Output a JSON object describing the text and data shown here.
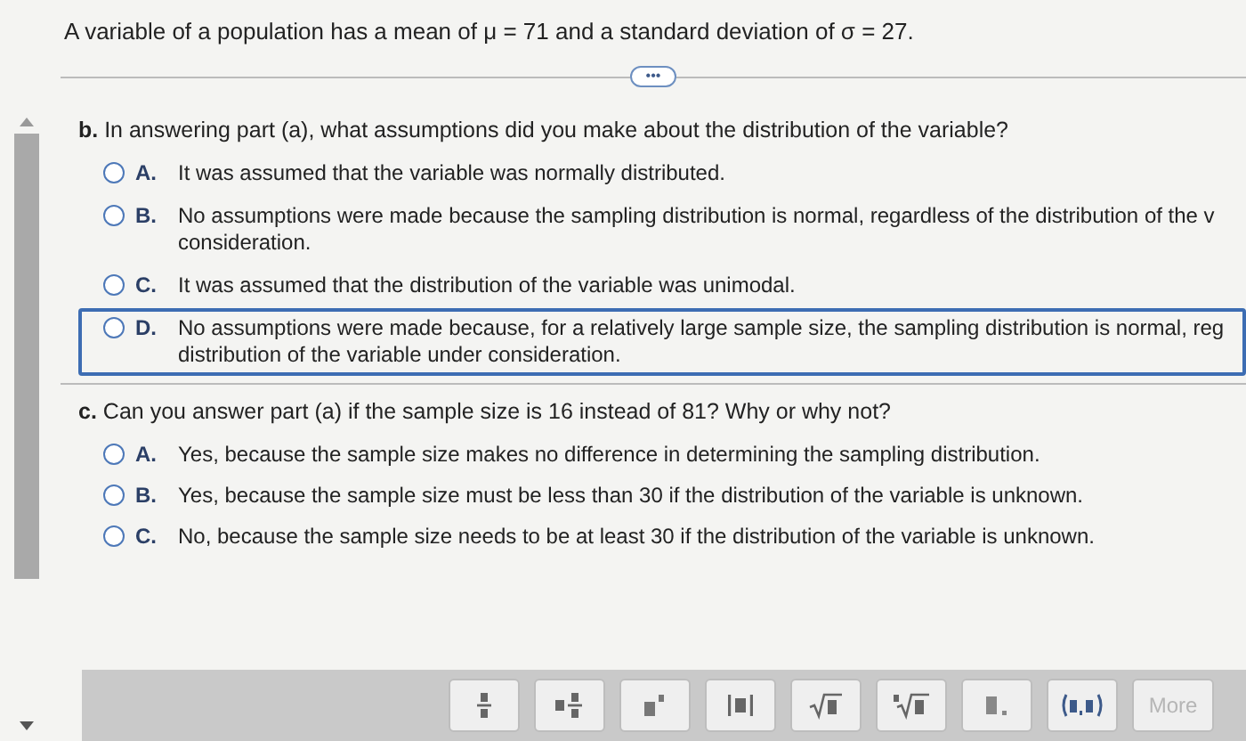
{
  "problem": {
    "statement": "A variable of a population has a mean of μ = 71 and a standard deviation of σ = 27.",
    "more_button": "•••"
  },
  "parts": [
    {
      "question": "**b.** In answering part (a), what assumptions did you make about the distribution of the variable?",
      "options": [
        {
          "letter": "A.",
          "text": "It was assumed that the variable was normally distributed.",
          "selected": false,
          "focused": false
        },
        {
          "letter": "B.",
          "text": "No assumptions were made because the sampling distribution is normal, regardless of the distribution of the v consideration.",
          "selected": false,
          "focused": false
        },
        {
          "letter": "C.",
          "text": "It was assumed that the distribution of the variable was unimodal.",
          "selected": false,
          "focused": false
        },
        {
          "letter": "D.",
          "text": "No assumptions were made because, for a relatively large sample size, the sampling distribution is normal, reg distribution of the variable under consideration.",
          "selected": false,
          "focused": true
        }
      ]
    },
    {
      "question": "**c.** Can you answer part (a) if the sample size is 16 instead of 81? Why or why not?",
      "options": [
        {
          "letter": "A.",
          "text": "Yes, because the sample size makes no difference in determining the sampling distribution.",
          "selected": false,
          "focused": false
        },
        {
          "letter": "B.",
          "text": "Yes, because the sample size must be less than 30 if the distribution of the variable is unknown.",
          "selected": false,
          "focused": false
        },
        {
          "letter": "C.",
          "text": "No, because the sample size needs to be at least 30 if the distribution of the variable is unknown.",
          "selected": false,
          "focused": false
        }
      ]
    }
  ],
  "math_toolbar": {
    "tools": [
      {
        "kind": "fraction"
      },
      {
        "kind": "mixed"
      },
      {
        "kind": "exponent"
      },
      {
        "kind": "absolute"
      },
      {
        "kind": "sqrt"
      },
      {
        "kind": "nthroot"
      },
      {
        "kind": "decimal"
      },
      {
        "kind": "pair"
      }
    ],
    "more": {
      "label": "More",
      "disabled": true
    }
  }
}
